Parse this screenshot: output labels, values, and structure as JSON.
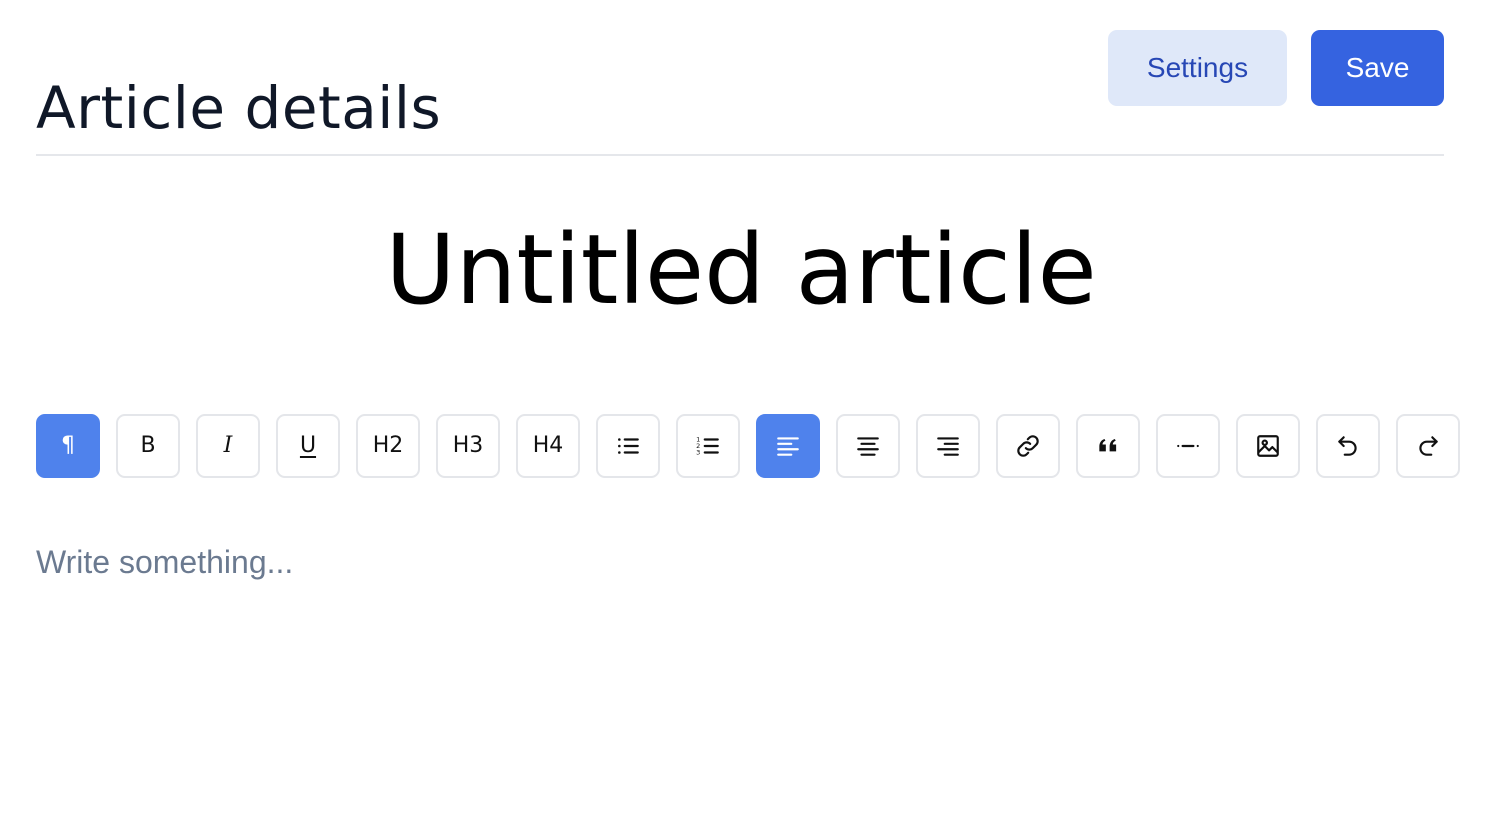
{
  "header": {
    "title": "Article details",
    "settings_label": "Settings",
    "save_label": "Save"
  },
  "article": {
    "title": "Untitled article",
    "body_placeholder": "Write something..."
  },
  "toolbar": {
    "buttons": [
      {
        "name": "paragraph",
        "icon": "paragraph-icon",
        "label": "¶",
        "active": true
      },
      {
        "name": "bold",
        "icon": "bold-icon",
        "label": "B",
        "active": false
      },
      {
        "name": "italic",
        "icon": "italic-icon",
        "label": "I",
        "active": false
      },
      {
        "name": "underline",
        "icon": "underline-icon",
        "label": "U",
        "active": false
      },
      {
        "name": "heading-2",
        "icon": "heading-2-icon",
        "label": "H2",
        "active": false
      },
      {
        "name": "heading-3",
        "icon": "heading-3-icon",
        "label": "H3",
        "active": false
      },
      {
        "name": "heading-4",
        "icon": "heading-4-icon",
        "label": "H4",
        "active": false
      },
      {
        "name": "bullet-list",
        "icon": "bullet-list-icon",
        "active": false
      },
      {
        "name": "ordered-list",
        "icon": "ordered-list-icon",
        "active": false
      },
      {
        "name": "align-left",
        "icon": "align-left-icon",
        "active": true
      },
      {
        "name": "align-center",
        "icon": "align-center-icon",
        "active": false
      },
      {
        "name": "align-right",
        "icon": "align-right-icon",
        "active": false
      },
      {
        "name": "link",
        "icon": "link-icon",
        "active": false
      },
      {
        "name": "blockquote",
        "icon": "quote-icon",
        "active": false
      },
      {
        "name": "horizontal-rule",
        "icon": "horizontal-rule-icon",
        "active": false
      },
      {
        "name": "image",
        "icon": "image-icon",
        "active": false
      },
      {
        "name": "undo",
        "icon": "undo-icon",
        "active": false
      },
      {
        "name": "redo",
        "icon": "redo-icon",
        "active": false
      }
    ]
  },
  "colors": {
    "accent": "#3563e0",
    "active_tool": "#4f82ec",
    "secondary_button_bg": "#dfe8f9",
    "secondary_button_text": "#2747b5",
    "placeholder_text": "#6b7a90",
    "border": "#e4e6ea"
  }
}
